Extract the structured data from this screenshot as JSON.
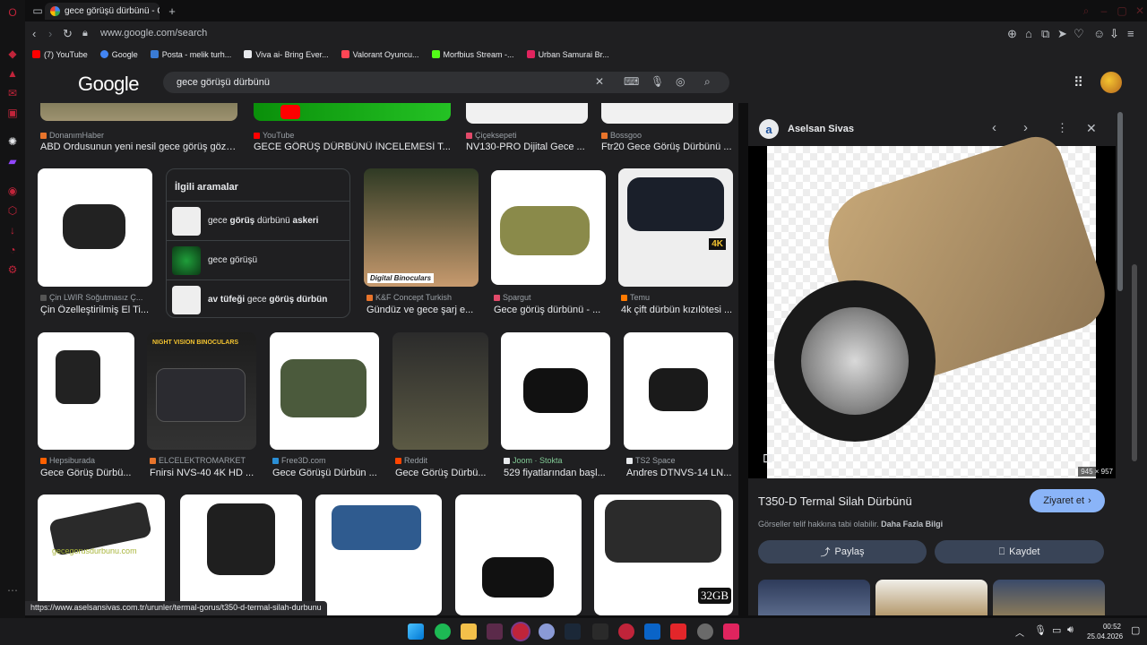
{
  "browser": {
    "tab_title": "gece görüşü dürbünü - Go",
    "url": "www.google.com/search",
    "bookmarks": [
      {
        "label": "(7) YouTube",
        "color": "#ff0000"
      },
      {
        "label": "Google",
        "color": "#4285f4"
      },
      {
        "label": "Posta - melik turh...",
        "color": "#3a7bd5"
      },
      {
        "label": "Viva ai- Bring Ever...",
        "color": "#e8eaed"
      },
      {
        "label": "Valorant Oyuncu...",
        "color": "#ff4655"
      },
      {
        "label": "Morfbius Stream -...",
        "color": "#53fc18"
      },
      {
        "label": "Urban Samurai Br...",
        "color": "#e0245e"
      }
    ]
  },
  "google": {
    "logo": "Google",
    "query": "gece görüşü dürbünü"
  },
  "results": {
    "row0": [
      {
        "source": "DonanımHaber",
        "title": "ABD Ordusunun yeni nesil gece görüş gözlü..."
      },
      {
        "source": "YouTube",
        "title": "GECE GÖRÜŞ DÜRBÜNÜ İNCELEMESİ T..."
      },
      {
        "source": "Çiçeksepeti",
        "title": "NV130-PRO Dijital Gece ..."
      },
      {
        "source": "Bossgoo",
        "title": "Ftr20 Gece Görüş Dürbünü ..."
      }
    ],
    "related": {
      "heading": "İlgili aramalar",
      "items": [
        {
          "pre": "gece ",
          "bold": "görüş",
          "mid": " dürbünü ",
          "bold2": "askeri"
        },
        {
          "pre": "gece görüşü",
          "bold": "",
          "mid": "",
          "bold2": ""
        },
        {
          "pre": "",
          "bold": "av tüfeği",
          "mid": " gece ",
          "bold2": "görüş dürbün"
        }
      ]
    },
    "row1": [
      {
        "source": "Çin LWIR Soğutmasız Ç...",
        "title": "Çin Özelleştirilmiş El Ti..."
      },
      {
        "source": "K&F Concept Turkish",
        "title": "Gündüz ve gece şarj e...",
        "overlay": "Digital Binoculars"
      },
      {
        "source": "Spargut",
        "title": "Gece görüş dürbünü - ..."
      },
      {
        "source": "Temu",
        "title": "4k çift dürbün kızılötesi ..."
      }
    ],
    "row2": [
      {
        "source": "Hepsiburada",
        "title": "Gece Görüş Dürbü..."
      },
      {
        "source": "ELCELEKTROMARKET",
        "title": "Fnirsi NVS-40 4K HD ...",
        "overlay": "NIGHT VISION BINOCULARS"
      },
      {
        "source": "Free3D.com",
        "title": "Gece Görüşü Dürbün ..."
      },
      {
        "source": "Reddit",
        "title": "Gece Görüş Dürbü..."
      },
      {
        "source": "Joom · Stokta",
        "title": "529 fiyatlarından başl..."
      },
      {
        "source": "TS2 Space",
        "title": "Andres DTNVS-14 LN..."
      }
    ],
    "row3_overlays": {
      "watermark": "gecegorusdurbunu.com",
      "badge": "32GB"
    }
  },
  "preview": {
    "site": "Aselsan Sivas",
    "dims": "945 × 957",
    "title": "T350-D Termal Silah Dürbünü",
    "visit": "Ziyaret et",
    "copyright": "Görseller telif hakkına tabi olabilir.",
    "learn_more": "Daha Fazla Bilgi",
    "share": "Paylaş",
    "save": "Kaydet"
  },
  "status_url": "https://www.aselsansivas.com.tr/urunler/termal-gorus/t350-d-termal-silah-durbunu",
  "clock": {
    "time": "00:52",
    "date": "25.04.2026"
  }
}
